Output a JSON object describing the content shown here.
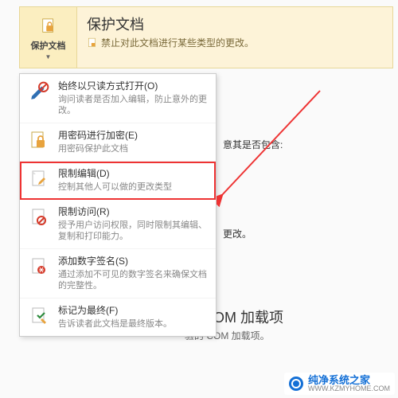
{
  "banner": {
    "button_label": "保护文档",
    "title": "保护文档",
    "subtitle": "禁止对此文档进行某些类型的更改。"
  },
  "menu": {
    "items": [
      {
        "title": "始终以只读方式打开(O)",
        "desc": "询问读者是否加入编辑，防止意外的更改。",
        "icon": "pencil"
      },
      {
        "title": "用密码进行加密(E)",
        "desc": "用密码保护此文档",
        "icon": "lock"
      },
      {
        "title": "限制编辑(D)",
        "desc": "控制其他人可以做的更改类型",
        "icon": "page-edit"
      },
      {
        "title": "限制访问(R)",
        "desc": "授予用户访问权限，同时限制其编辑、复制和打印能力。",
        "icon": "page-restrict"
      },
      {
        "title": "添加数字签名(S)",
        "desc": "通过添加不可见的数字签名来确保文档的完整性。",
        "icon": "signature"
      },
      {
        "title": "标记为最终(F)",
        "desc": "告诉读者此文档是最终版本。",
        "icon": "final"
      }
    ]
  },
  "background": {
    "line1": "意其是否包含:",
    "line2": "更改。",
    "heading": "的 COM 加载项",
    "sub": "验的 COM 加载项。"
  },
  "watermark": {
    "name": "纯净系统之家",
    "url": "WWW.KZMYHOME.COM"
  },
  "colors": {
    "accent_red": "#e33",
    "accent_blue": "#1470d6",
    "banner_bg": "#fdf3d8"
  }
}
